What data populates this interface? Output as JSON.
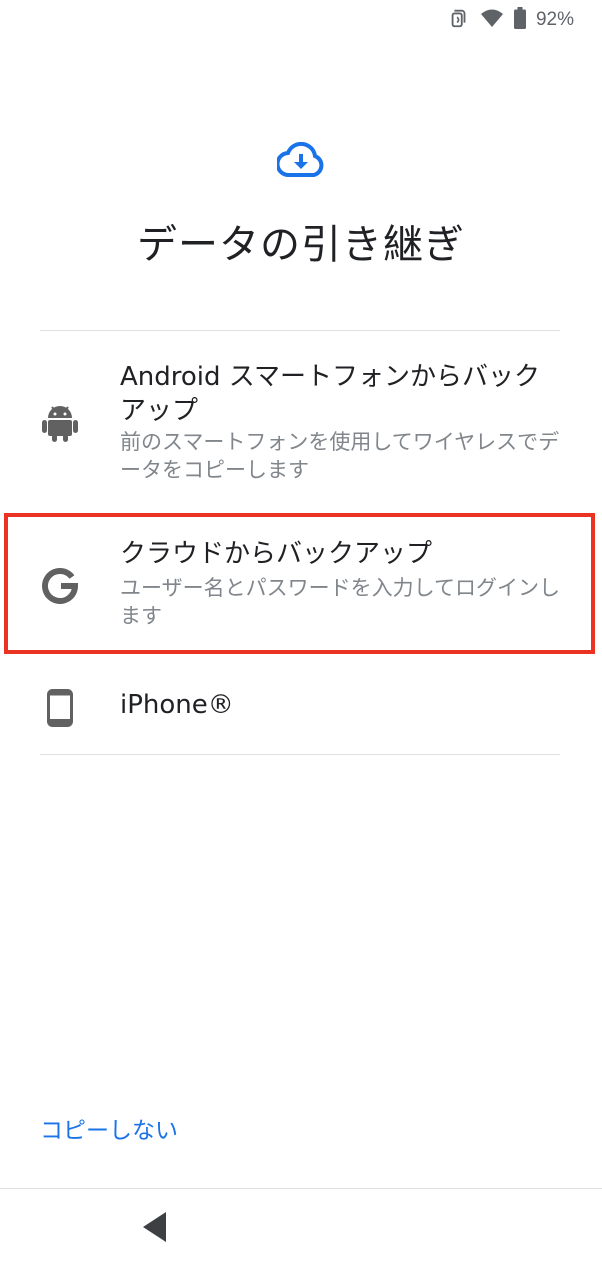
{
  "status_bar": {
    "battery_percent": "92%",
    "icons": [
      "nfc-icon",
      "wifi-icon",
      "battery-icon"
    ]
  },
  "header": {
    "icon": "cloud-download-icon",
    "title": "データの引き継ぎ"
  },
  "options": [
    {
      "icon": "android-icon",
      "title": "Android スマートフォンからバックアップ",
      "subtitle": "前のスマートフォンを使用してワイヤレスでデータをコピーします"
    },
    {
      "icon": "google-g-icon",
      "title": "クラウドからバックアップ",
      "subtitle": "ユーザー名とパスワードを入力してログインします"
    },
    {
      "icon": "phone-icon",
      "title": "iPhone®",
      "subtitle": ""
    }
  ],
  "footer": {
    "skip_label": "コピーしない"
  },
  "nav": {
    "back_icon": "back-triangle-icon"
  },
  "colors": {
    "accent": "#1a73e8",
    "highlight": "#ea3323",
    "icon_gray": "#616161",
    "subtext": "#80868b"
  }
}
